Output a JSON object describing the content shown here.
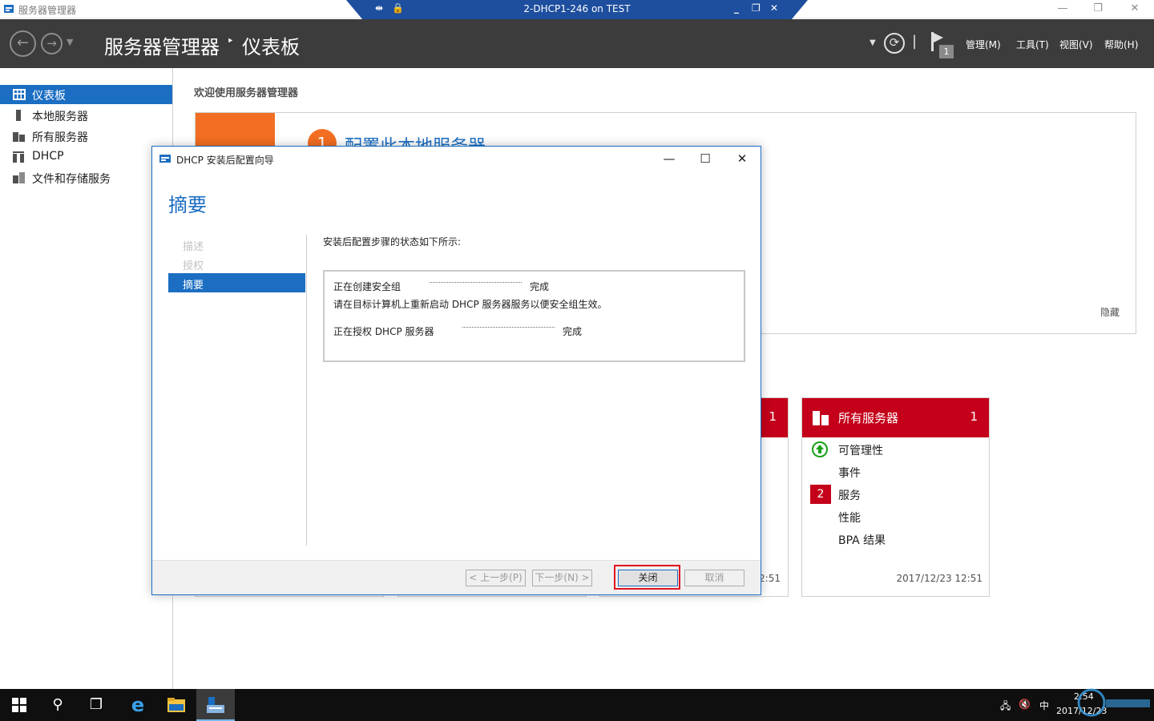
{
  "window": {
    "title": "服务器管理器",
    "rdp_title": "2-DHCP1-246 on TEST"
  },
  "header": {
    "title": "服务器管理器",
    "separator": "‣",
    "subtitle": "仪表板",
    "flag_count": "1",
    "menus": [
      "管理(M)",
      "工具(T)",
      "视图(V)",
      "帮助(H)"
    ]
  },
  "sidebar": {
    "items": [
      {
        "label": "仪表板",
        "icon": "dashboard-icon",
        "active": true
      },
      {
        "label": "本地服务器",
        "icon": "server-icon"
      },
      {
        "label": "所有服务器",
        "icon": "servers-icon"
      },
      {
        "label": "DHCP",
        "icon": "dhcp-icon"
      },
      {
        "label": "文件和存储服务",
        "icon": "storage-icon"
      }
    ]
  },
  "dashboard": {
    "welcome": "欢迎使用服务器管理器",
    "quickstart_step": "1",
    "quickstart_title": "配置此本地服务器",
    "hide_link": "隐藏",
    "partial_tile": {
      "count": "1",
      "date": "2:51"
    },
    "all_servers_tile": {
      "name": "所有服务器",
      "count": "1",
      "rows": [
        "可管理性",
        "事件",
        "服务",
        "性能",
        "BPA 结果"
      ],
      "services_badge": "2",
      "date": "2017/12/23 12:51"
    }
  },
  "dialog": {
    "title": "DHCP 安装后配置向导",
    "heading": "摘要",
    "steps": [
      "描述",
      "授权",
      "摘要"
    ],
    "intro": "安装后配置步骤的状态如下所示:",
    "results": [
      {
        "label": "正在创建安全组",
        "status": "完成"
      },
      {
        "note": "请在目标计算机上重新启动 DHCP 服务器服务以便安全组生效。"
      },
      {
        "label": "正在授权 DHCP 服务器",
        "status": "完成"
      }
    ],
    "buttons": {
      "prev": "< 上一步(P)",
      "next": "下一步(N) >",
      "close": "关闭",
      "cancel": "取消"
    }
  },
  "taskbar": {
    "ime": "中",
    "time": "2:54",
    "date": "2017/12/23"
  },
  "colors": {
    "accent": "#1b6ec2",
    "header_bg": "#3c3c3c",
    "tile_red": "#c4001a",
    "quickstart_orange": "#f26e22",
    "highlight_red": "#e0141e"
  }
}
